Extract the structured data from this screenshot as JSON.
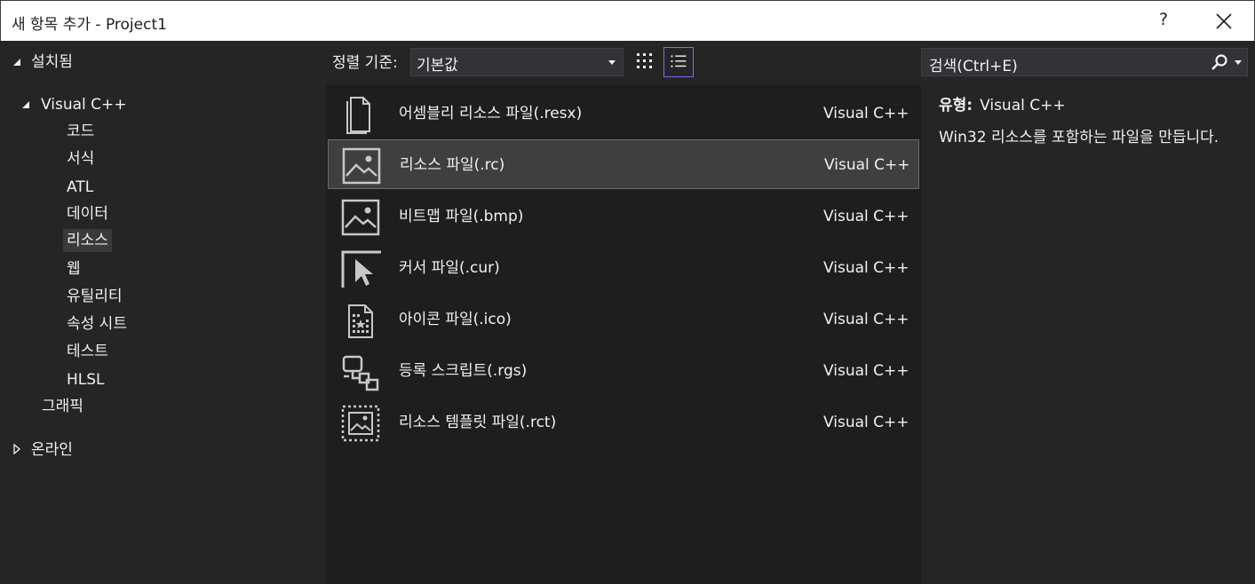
{
  "window": {
    "title": "새 항목 추가 - Project1",
    "help_label": "?"
  },
  "tree": {
    "installed": "설치됨",
    "visual_cpp": "Visual C++",
    "items": [
      "코드",
      "서식",
      "ATL",
      "데이터",
      "리소스",
      "웹",
      "유틸리티",
      "속성 시트",
      "테스트",
      "HLSL"
    ],
    "selected": "리소스",
    "graphics": "그래픽",
    "online": "온라인"
  },
  "toolbar": {
    "sort_label": "정렬 기준:",
    "sort_value": "기본값"
  },
  "search": {
    "placeholder": "검색(Ctrl+E)"
  },
  "templates": [
    {
      "name": "어셈블리 리소스 파일(.resx)",
      "lang": "Visual C++",
      "icon": "document-icon"
    },
    {
      "name": "리소스 파일(.rc)",
      "lang": "Visual C++",
      "icon": "image-icon"
    },
    {
      "name": "비트맵 파일(.bmp)",
      "lang": "Visual C++",
      "icon": "image-icon"
    },
    {
      "name": "커서 파일(.cur)",
      "lang": "Visual C++",
      "icon": "cursor-icon"
    },
    {
      "name": "아이콘 파일(.ico)",
      "lang": "Visual C++",
      "icon": "icon-file-icon"
    },
    {
      "name": "등록 스크립트(.rgs)",
      "lang": "Visual C++",
      "icon": "registry-script-icon"
    },
    {
      "name": "리소스 템플릿 파일(.rct)",
      "lang": "Visual C++",
      "icon": "image-template-icon"
    }
  ],
  "details": {
    "type_label": "유형:",
    "type_value": "Visual C++",
    "description": "Win32 리소스를 포함하는 파일을 만듭니다."
  },
  "colors": {
    "accent": "#7b6cf5",
    "background": "#252526",
    "list_bg": "#1e1e1e"
  }
}
